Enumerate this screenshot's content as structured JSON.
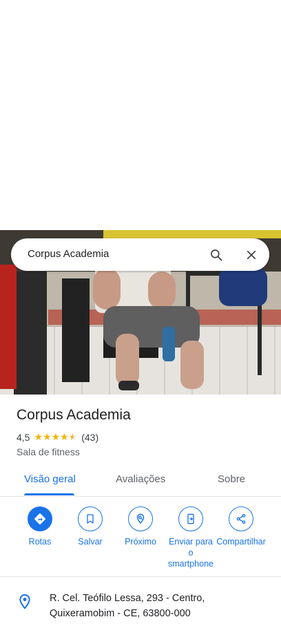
{
  "search": {
    "query": "Corpus Academia",
    "search_icon": "search-icon",
    "close_icon": "close-icon"
  },
  "place": {
    "name": "Corpus Academia",
    "rating": "4,5",
    "stars": 4.5,
    "review_count": "(43)",
    "category": "Sala de fitness"
  },
  "tabs": [
    {
      "label": "Visão geral",
      "active": true
    },
    {
      "label": "Avaliações",
      "active": false
    },
    {
      "label": "Sobre",
      "active": false
    }
  ],
  "actions": [
    {
      "label": "Rotas",
      "icon": "directions-icon"
    },
    {
      "label": "Salvar",
      "icon": "bookmark-icon"
    },
    {
      "label": "Próximo",
      "icon": "nearby-icon"
    },
    {
      "label": "Enviar para o smartphone",
      "icon": "send-to-phone-icon"
    },
    {
      "label": "Compartilhar",
      "icon": "share-icon"
    }
  ],
  "address": {
    "text": "R. Cel. Teófilo Lessa, 293 - Centro, Quixeramobim - CE, 63800-000",
    "icon": "location-pin-icon"
  },
  "colors": {
    "accent": "#1a73e8",
    "star": "#f5b400",
    "text": "#202124",
    "secondary": "#5f6368"
  }
}
